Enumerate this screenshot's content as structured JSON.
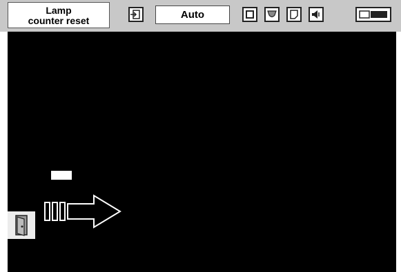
{
  "menu": {
    "title_line1": "Lamp",
    "title_line2": "counter reset",
    "mode_value": "Auto",
    "icons": [
      "input-icon",
      "square-icon",
      "shield-icon",
      "page-icon",
      "speaker-icon",
      "projector-icon"
    ]
  },
  "colors": {
    "menubar": "#c8c8c8",
    "screen": "#000000",
    "title_bg": "#ffffff"
  }
}
